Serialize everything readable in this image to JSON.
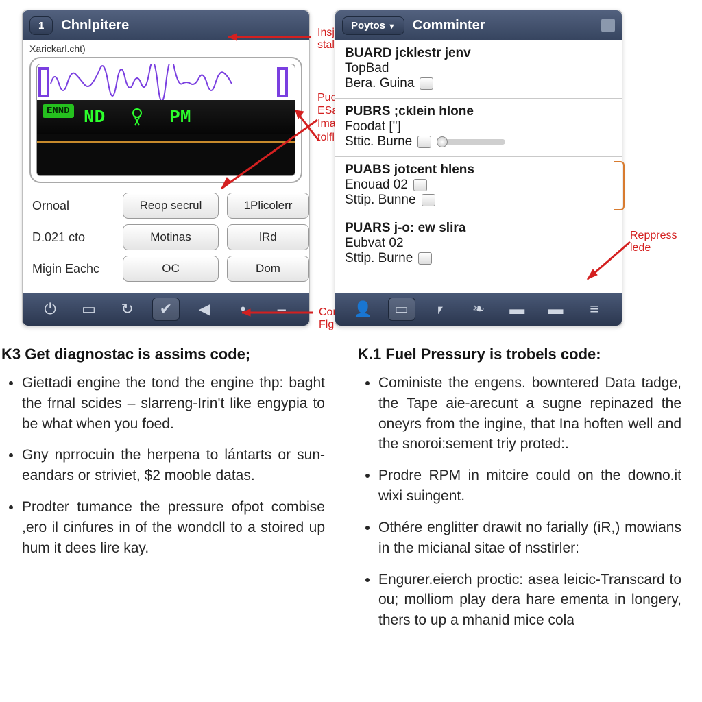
{
  "left": {
    "pill": "1",
    "title": "Chnlpitere",
    "subhead": "Xarickarl.cht)",
    "readout_badge": "ENND",
    "readout_main": "ND",
    "readout_right": "PM",
    "labels": {
      "r1": "Ornoal",
      "r2": "D.021 cto",
      "r3": "Migin Eachc"
    },
    "buttons": {
      "b11": "Reop secrul",
      "b12": "1Plicolerr",
      "b21": "Motinas",
      "b22": "lRd",
      "b31": "OC",
      "b32": "Dom"
    },
    "annos": {
      "a1": "Insjer stal",
      "a2": "Puco-arrvito ESalinbaculics Imagu like tolfled",
      "a3": "Comus Flg"
    }
  },
  "right": {
    "pill": "Poytos",
    "title": "Comminter",
    "groups": [
      {
        "l1": "BUARD jcklestr jenv",
        "l2": "TopBad",
        "l3": "Bera. Guina"
      },
      {
        "l1": "PUBRS ;cklein hlone",
        "l2": "Foodat [\"]",
        "l3": "Sttic. Burne",
        "slider": true
      },
      {
        "l1": "PUABS jotcent hlens",
        "l2": "Enouad  02",
        "l3": "Sttip. Bunne"
      },
      {
        "l1": "PUARS j-o: ew   slira",
        "l2": "Eubvat  02",
        "l3": "Sttip. Burne"
      }
    ],
    "anno": "Reppress lede"
  },
  "colL": {
    "head": "K3 Get diagnostac is assims code;",
    "items": [
      "Giettadi engine the tond the engine thp: baght the frnal scides – slarreng-Irin't like engypia to be what when you foed.",
      "Gny nprrocuin the herpena to lántarts or sun-eandars or striviet, $2 mooble datas.",
      "Prodter tumance the pressure ofpot combise ,ero il cinfures in of the wondcll to a stoired up hum it dees lire kay."
    ]
  },
  "colR": {
    "head": "K.1 Fuel Pressury is trobels code:",
    "items": [
      "Coministe the engens. bowntered Data tadge, the Tape aie-arecunt a sugne repinazed the oneyrs from the ingine, that Ina hoften well and the snoroi:sement triy proted:.",
      "Prodre RPM in mitcire could on the downo.it wixi suingent.",
      "Othére englitter drawit no farially (iR,) mowians in the micianal sitae of nsstirler:",
      "Engurer.eierch proctic: asea leicic-Transcard to ou; molliom play dera hare ementa in longery, thers to up a mhanid mice cola"
    ]
  }
}
